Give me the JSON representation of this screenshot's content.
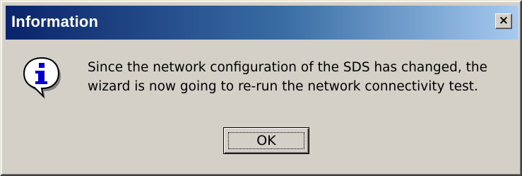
{
  "dialog": {
    "title": "Information",
    "close_label": "×",
    "icon": "information-icon",
    "message_lines": [
      "Since the network configuration of the SDS has changed, the",
      "wizard is now going to re-run the network connectivity test."
    ],
    "ok_label": "OK"
  },
  "colors": {
    "title_bar_start": "#0a246a",
    "title_bar_end": "#a6caf0",
    "dialog_background": "#d4d0c8",
    "icon_letter": "#0000c8"
  }
}
